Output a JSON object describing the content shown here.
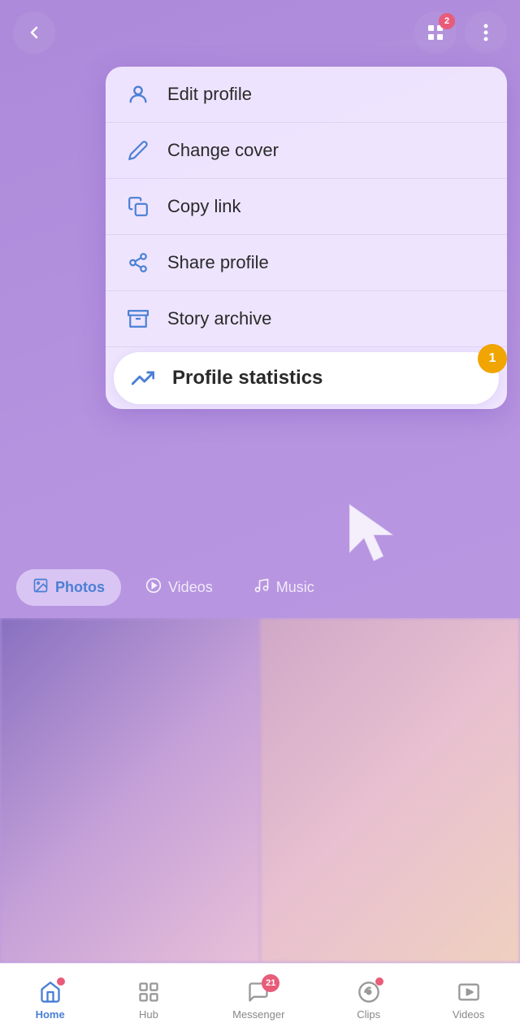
{
  "topBar": {
    "backLabel": "back",
    "gridBadge": "2",
    "dotsLabel": "more options"
  },
  "menu": {
    "items": [
      {
        "id": "edit-profile",
        "label": "Edit profile",
        "icon": "person-icon",
        "active": false
      },
      {
        "id": "change-cover",
        "label": "Change cover",
        "icon": "pencil-icon",
        "active": false
      },
      {
        "id": "copy-link",
        "label": "Copy link",
        "icon": "copy-icon",
        "active": false
      },
      {
        "id": "share-profile",
        "label": "Share profile",
        "icon": "share-icon",
        "active": false
      },
      {
        "id": "story-archive",
        "label": "Story archive",
        "icon": "archive-icon",
        "active": false
      },
      {
        "id": "profile-statistics",
        "label": "Profile statistics",
        "icon": "chart-icon",
        "active": true,
        "badge": "1"
      }
    ]
  },
  "tabs": [
    {
      "id": "photos",
      "label": "Photos",
      "active": true
    },
    {
      "id": "videos",
      "label": "Videos",
      "active": false
    },
    {
      "id": "music",
      "label": "Music",
      "active": false
    }
  ],
  "bottomNav": [
    {
      "id": "home",
      "label": "Home",
      "icon": "home-icon",
      "active": true,
      "dot": true
    },
    {
      "id": "hub",
      "label": "Hub",
      "icon": "hub-icon",
      "active": false
    },
    {
      "id": "messenger",
      "label": "Messenger",
      "icon": "messenger-icon",
      "active": false,
      "badge": "21"
    },
    {
      "id": "clips",
      "label": "Clips",
      "icon": "clips-icon",
      "active": false,
      "dot": true
    },
    {
      "id": "videos",
      "label": "Videos",
      "icon": "videos-icon",
      "active": false
    }
  ]
}
